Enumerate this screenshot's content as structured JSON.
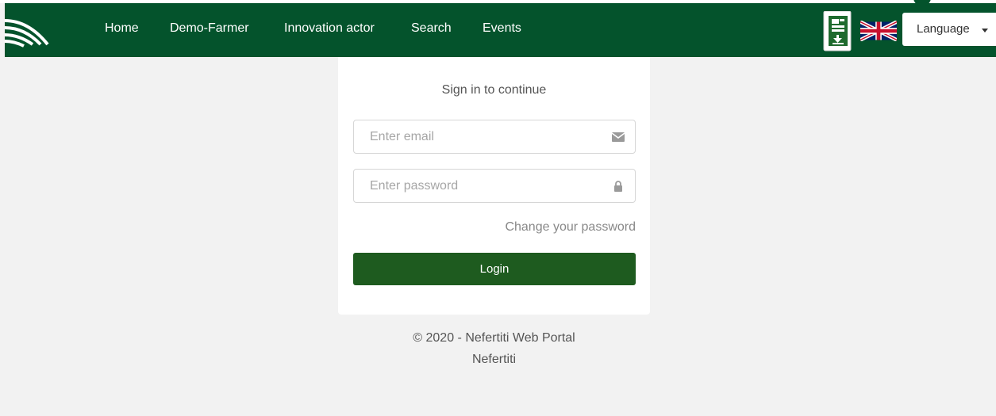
{
  "nav": {
    "logo_icon": "nefertiti-wave-logo-icon",
    "items": [
      {
        "label": "Home"
      },
      {
        "label": "Demo-Farmer"
      },
      {
        "label": "Innovation actor"
      },
      {
        "label": "Search"
      },
      {
        "label": "Events"
      }
    ],
    "app_icon": "app-download-icon",
    "flag_icon": "uk-flag-icon",
    "language_label": "Language",
    "colors": {
      "navbar": "#04532c",
      "text": "#ffffff"
    }
  },
  "login": {
    "title": "Sign in to continue",
    "email_placeholder": "Enter email",
    "email_icon": "envelope-icon",
    "password_placeholder": "Enter password",
    "password_icon": "lock-icon",
    "change_password": "Change your password",
    "login_label": "Login",
    "login_color": "#1e5b1f"
  },
  "footer": {
    "copyright": "© 2020 - Nefertiti Web Portal",
    "name": "Nefertiti"
  }
}
